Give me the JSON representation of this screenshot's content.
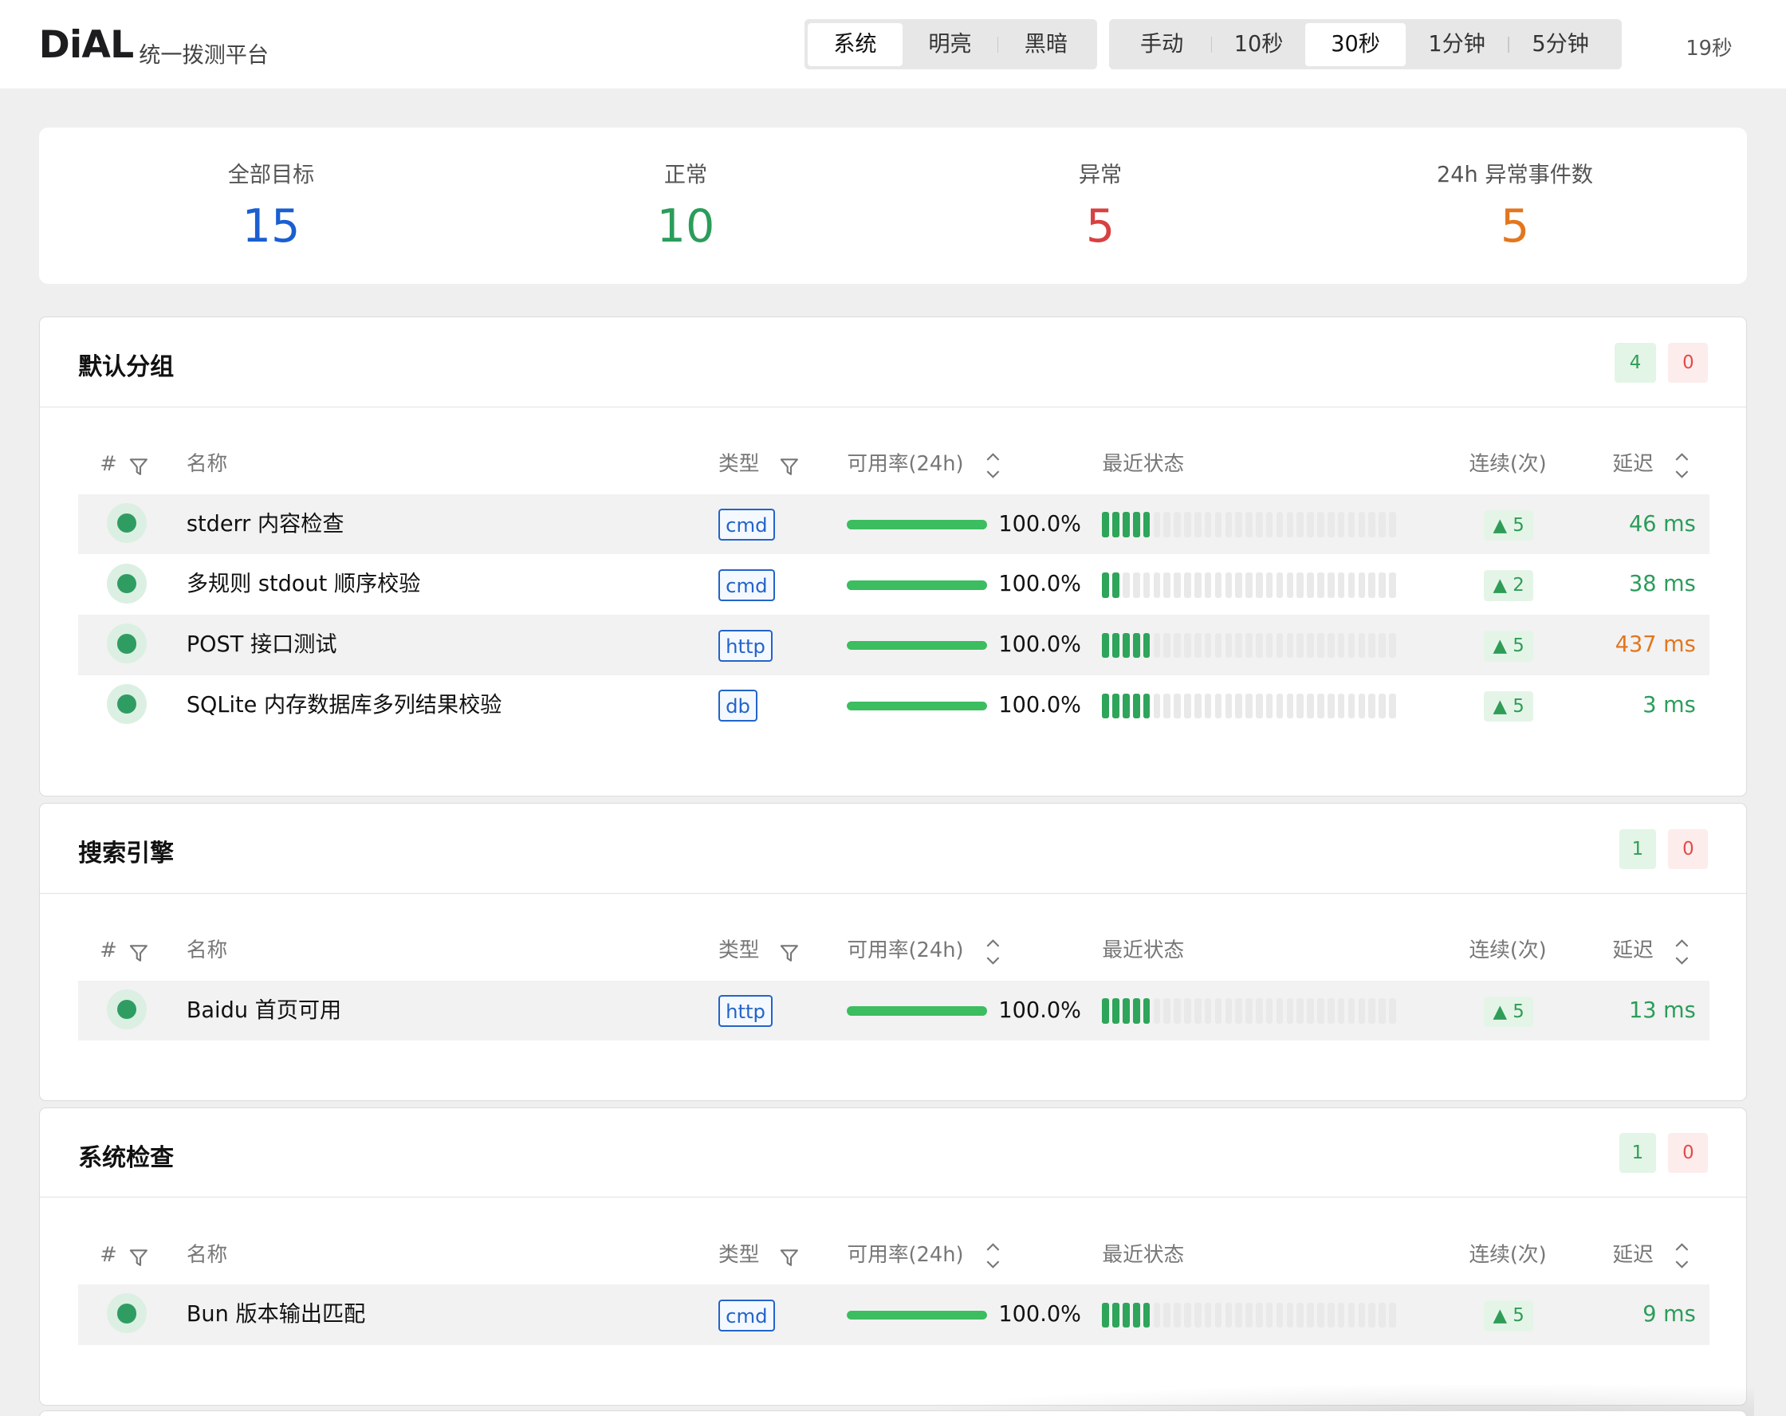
{
  "header": {
    "brand": "DiAL",
    "subtitle": "统一拨测平台",
    "theme_options": [
      "系统",
      "明亮",
      "黑暗"
    ],
    "theme_selected": "系统",
    "refresh_options": [
      "手动",
      "10秒",
      "30秒",
      "1分钟",
      "5分钟"
    ],
    "refresh_selected": "30秒",
    "countdown": "19秒"
  },
  "summary": {
    "total": {
      "label": "全部目标",
      "value": "15",
      "color": "#1a5fd1"
    },
    "ok": {
      "label": "正常",
      "value": "10",
      "color": "#2a9d5a"
    },
    "bad": {
      "label": "异常",
      "value": "5",
      "color": "#d84141"
    },
    "events": {
      "label": "24h 异常事件数",
      "value": "5",
      "color": "#e3761d"
    }
  },
  "table_headers": {
    "index": "#",
    "name": "名称",
    "type": "类型",
    "availability": "可用率(24h)",
    "recent": "最近状态",
    "streak": "连续(次)",
    "latency": "延迟"
  },
  "groups": [
    {
      "title": "默认分组",
      "ok_count": "4",
      "bad_count": "0",
      "rows": [
        {
          "name": "stderr 内容检查",
          "type": "cmd",
          "availability": "100.0%",
          "availability_fraction": 1.0,
          "recent_ok": 5,
          "streak": "▲ 5",
          "latency": "46 ms",
          "latency_color": "#2a9d5a"
        },
        {
          "name": "多规则 stdout 顺序校验",
          "type": "cmd",
          "availability": "100.0%",
          "availability_fraction": 1.0,
          "recent_ok": 2,
          "streak": "▲ 2",
          "latency": "38 ms",
          "latency_color": "#2a9d5a"
        },
        {
          "name": "POST 接口测试",
          "type": "http",
          "availability": "100.0%",
          "availability_fraction": 1.0,
          "recent_ok": 5,
          "streak": "▲ 5",
          "latency": "437 ms",
          "latency_color": "#e3761d"
        },
        {
          "name": "SQLite 内存数据库多列结果校验",
          "type": "db",
          "availability": "100.0%",
          "availability_fraction": 1.0,
          "recent_ok": 5,
          "streak": "▲ 5",
          "latency": "3 ms",
          "latency_color": "#2a9d5a"
        }
      ]
    },
    {
      "title": "搜索引擎",
      "ok_count": "1",
      "bad_count": "0",
      "rows": [
        {
          "name": "Baidu 首页可用",
          "type": "http",
          "availability": "100.0%",
          "availability_fraction": 1.0,
          "recent_ok": 5,
          "streak": "▲ 5",
          "latency": "13 ms",
          "latency_color": "#2a9d5a"
        }
      ]
    },
    {
      "title": "系统检查",
      "ok_count": "1",
      "bad_count": "0",
      "rows": [
        {
          "name": "Bun 版本输出匹配",
          "type": "cmd",
          "availability": "100.0%",
          "availability_fraction": 1.0,
          "recent_ok": 5,
          "streak": "▲ 5",
          "latency": "9 ms",
          "latency_color": "#2a9d5a"
        }
      ]
    }
  ],
  "icons": {
    "filter": "filter-icon",
    "sort": "sort-icon",
    "status": "status-dot-icon"
  }
}
